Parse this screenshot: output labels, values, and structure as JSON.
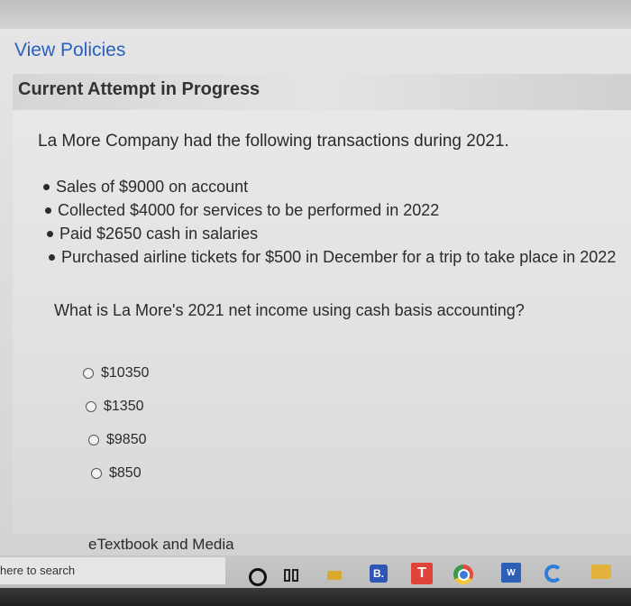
{
  "header": {
    "view_policies": "View Policies",
    "attempt_title": "Current Attempt in Progress"
  },
  "question": {
    "intro": "La More Company had the following transactions during 2021.",
    "bullets": [
      "Sales of $9000 on account",
      "Collected $4000 for services to be performed in 2022",
      "Paid $2650 cash in salaries",
      "Purchased airline tickets for $500 in December for a trip to take place in 2022"
    ],
    "prompt": "What is La More's 2021 net income using cash basis accounting?",
    "options": [
      "$10350",
      "$1350",
      "$9850",
      "$850"
    ]
  },
  "resources": {
    "etextbook": "eTextbook and Media"
  },
  "taskbar": {
    "search_placeholder": "here to search",
    "b_icon_label": "B.",
    "t_icon_label": "T",
    "word_icon_label": "W"
  }
}
